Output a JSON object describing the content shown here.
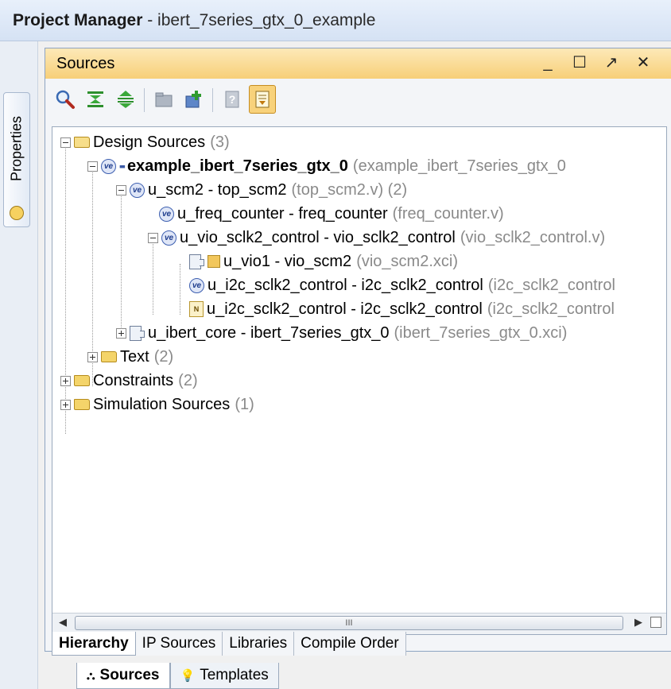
{
  "title_bar": {
    "app": "Project Manager",
    "project": " - ibert_7series_gtx_0_example"
  },
  "left_strip": {
    "properties_tab": "Properties"
  },
  "panel": {
    "title": "Sources",
    "controls": {
      "minimize": "_",
      "maximize": "☐",
      "float": "↗",
      "close": "✕"
    }
  },
  "toolbar": {
    "buttons": [
      {
        "icon": "search-icon"
      },
      {
        "icon": "collapse-all-icon"
      },
      {
        "icon": "expand-all-icon"
      },
      {
        "icon": "folder-open-icon"
      },
      {
        "icon": "add-sources-icon"
      },
      {
        "icon": "help-icon"
      },
      {
        "icon": "show-hierarchy-icon"
      }
    ]
  },
  "tree": {
    "design_sources": {
      "name": "Design Sources",
      "meta": "(3)"
    },
    "top": {
      "name": "example_ibert_7series_gtx_0",
      "meta": "(example_ibert_7series_gtx_0"
    },
    "u_scm2": {
      "name": "u_scm2 - top_scm2",
      "meta": "(top_scm2.v) (2)"
    },
    "u_freq_counter": {
      "name": "u_freq_counter - freq_counter",
      "meta": "(freq_counter.v)"
    },
    "u_vio_sclk2_control": {
      "name": "u_vio_sclk2_control - vio_sclk2_control",
      "meta": "(vio_sclk2_control.v)"
    },
    "u_vio1": {
      "name": "u_vio1 - vio_scm2",
      "meta": "(vio_scm2.xci)"
    },
    "u_i2c_1": {
      "name": "u_i2c_sclk2_control - i2c_sclk2_control",
      "meta": "(i2c_sclk2_control"
    },
    "u_i2c_2": {
      "name": "u_i2c_sclk2_control - i2c_sclk2_control",
      "meta": "(i2c_sclk2_control"
    },
    "u_ibert_core": {
      "name": "u_ibert_core - ibert_7series_gtx_0",
      "meta": "(ibert_7series_gtx_0.xci)"
    },
    "text": {
      "name": "Text",
      "meta": "(2)"
    },
    "constraints": {
      "name": "Constraints",
      "meta": "(2)"
    },
    "simulation_sources": {
      "name": "Simulation Sources",
      "meta": "(1)"
    }
  },
  "scrollbar": {
    "grip": "III"
  },
  "inner_tabs": [
    "Hierarchy",
    "IP Sources",
    "Libraries",
    "Compile Order"
  ],
  "bottom_tabs": [
    {
      "label": "Sources",
      "icon": "sources-icon"
    },
    {
      "label": "Templates",
      "icon": "lightbulb-icon"
    }
  ],
  "colors": {
    "panel_header": "#f7cf78",
    "meta_text": "#8a8a8a",
    "active_toolbar": "#f8d27b"
  }
}
